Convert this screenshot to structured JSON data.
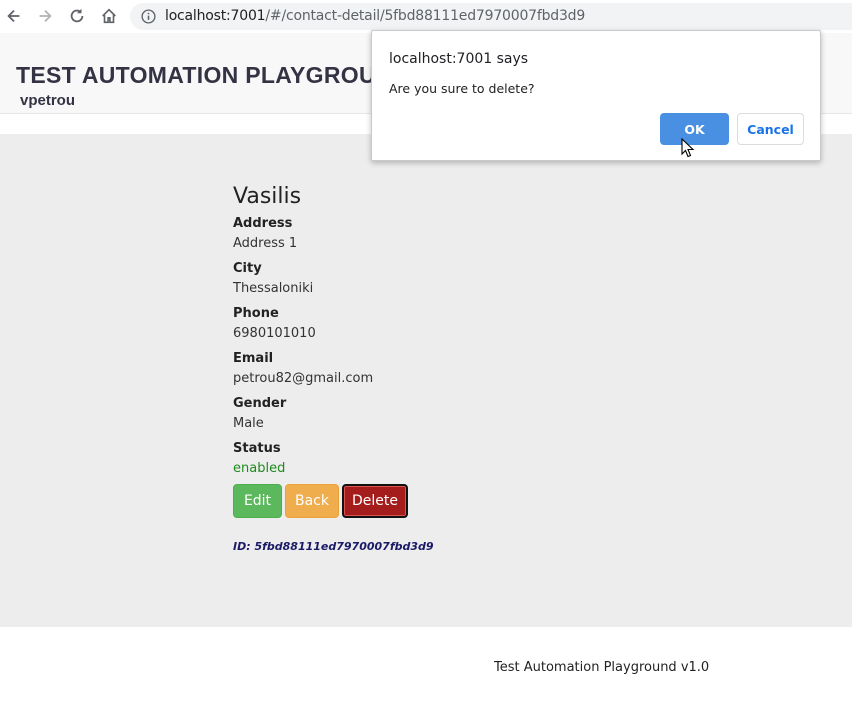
{
  "browser": {
    "url_host": "localhost:7001",
    "url_path": "/#/contact-detail/5fbd88111ed7970007fbd3d9"
  },
  "header": {
    "title": "TEST AUTOMATION PLAYGROU",
    "user": "vpetrou"
  },
  "contact": {
    "name": "Vasilis",
    "fields": [
      {
        "label": "Address",
        "value": "Address 1"
      },
      {
        "label": "City",
        "value": "Thessaloniki"
      },
      {
        "label": "Phone",
        "value": "6980101010"
      },
      {
        "label": "Email",
        "value": "petrou82@gmail.com"
      },
      {
        "label": "Gender",
        "value": "Male"
      },
      {
        "label": "Status",
        "value": "enabled"
      }
    ],
    "buttons": {
      "edit": "Edit",
      "back": "Back",
      "delete": "Delete"
    },
    "id_text": "ID: 5fbd88111ed7970007fbd3d9"
  },
  "footer": {
    "text": "Test Automation Playground v1.0"
  },
  "dialog": {
    "title": "localhost:7001 says",
    "message": "Are you sure to delete?",
    "ok_label": "OK",
    "cancel_label": "Cancel"
  },
  "colors": {
    "status_enabled": "#1e8a1e",
    "edit_button": "#5cb85c",
    "back_button": "#f0ad4e",
    "delete_button": "#a51c1c",
    "dialog_ok": "#4a90e2"
  }
}
